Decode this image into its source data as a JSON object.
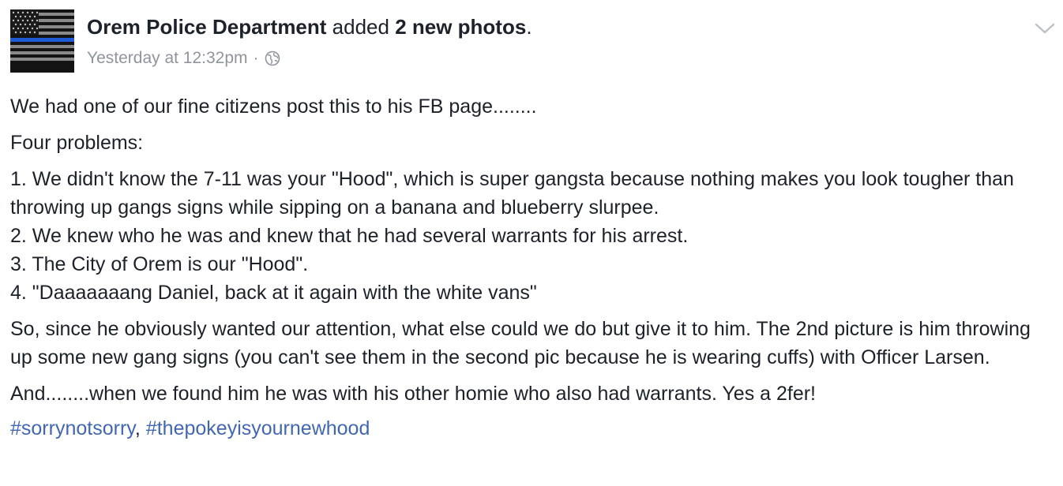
{
  "post": {
    "author": "Orem Police Department",
    "action_pre": " added ",
    "action_bold": "2 new photos",
    "action_post": ".",
    "timestamp": "Yesterday at 12:32pm",
    "separator": "·",
    "privacy_icon": "globe-icon",
    "menu_icon": "chevron-down-icon",
    "avatar_icon": "thin-blue-line-flag"
  },
  "body": {
    "p1": "We had one of our fine citizens post this to his FB page........",
    "p2": "Four problems:",
    "p3": "1. We didn't know the 7-11 was your \"Hood\", which is super gangsta because nothing makes you look tougher than throwing up gangs signs while sipping on a banana and blueberry slurpee.\n2. We knew who he was and knew that he had several warrants for his arrest.\n3. The City of Orem is our \"Hood\".\n4. \"Daaaaaaang Daniel, back at it again with the white vans\"",
    "p4": "So, since he obviously wanted our attention, what else could we do but give it to him. The 2nd picture is him throwing up some new gang signs (you can't see them in the second pic because he is wearing cuffs) with Officer Larsen.",
    "p5": "And........when we found him he was with his other homie who also had warrants. Yes a 2fer!",
    "hashtag1": "#sorrynotsorry",
    "hashtag_sep": ", ",
    "hashtag2": "#thepokeyisyournewhood"
  },
  "colors": {
    "text": "#1d2129",
    "meta": "#90949c",
    "link": "#4267b2",
    "flag_blue": "#1f5bd6"
  }
}
